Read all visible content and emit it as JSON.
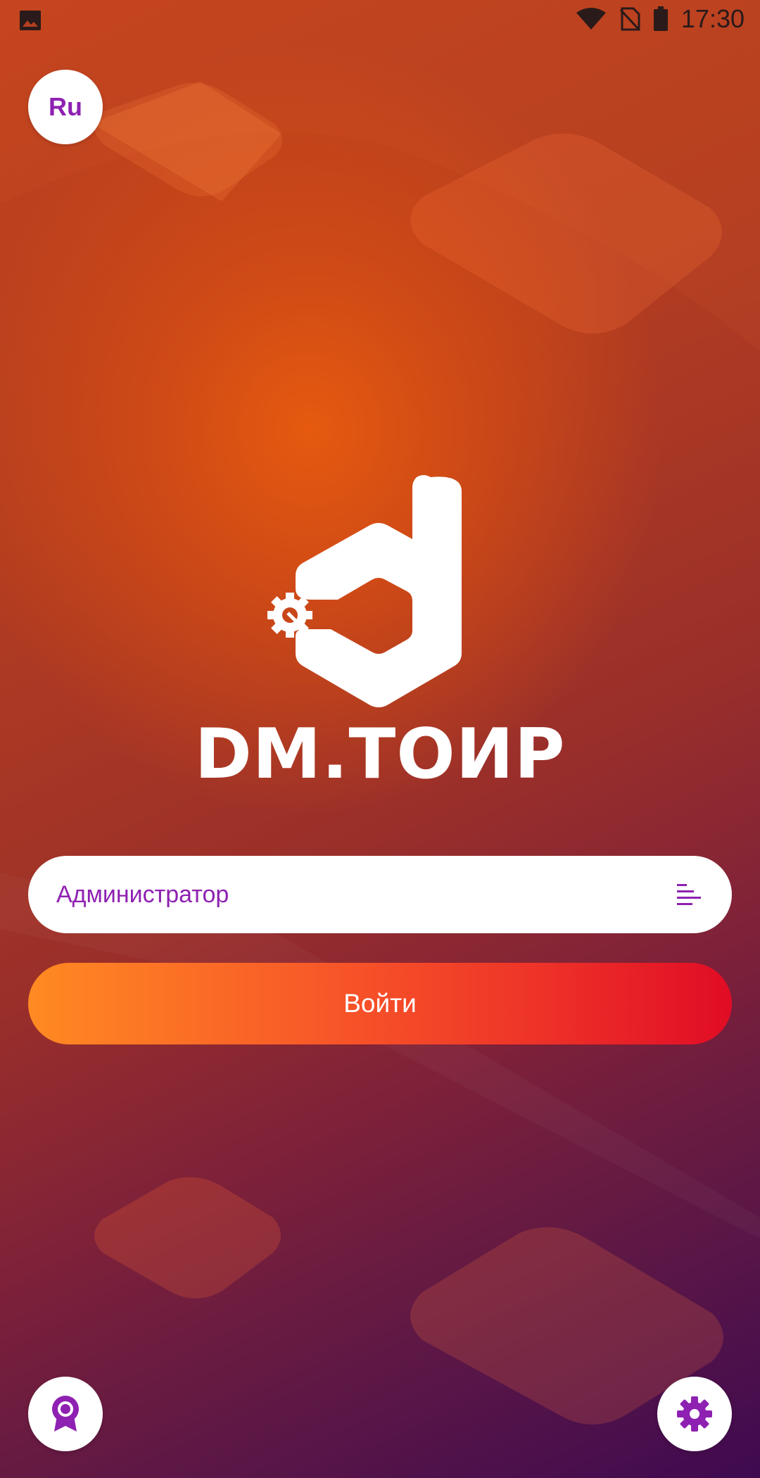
{
  "status_bar": {
    "time": "17:30",
    "icons": [
      "image-icon",
      "wifi-icon",
      "no-sim-icon",
      "battery-icon"
    ]
  },
  "language": {
    "label": "Ru"
  },
  "brand": {
    "name": "DM.ТОИР"
  },
  "login_form": {
    "user_value": "Администратор",
    "login_label": "Войти"
  },
  "bottom": {
    "left_icon": "badge-icon",
    "right_icon": "gear-icon"
  },
  "colors": {
    "accent_purple": "#8e21b1",
    "button_gradient_start": "#ff8a22",
    "button_gradient_end": "#e00c25"
  }
}
